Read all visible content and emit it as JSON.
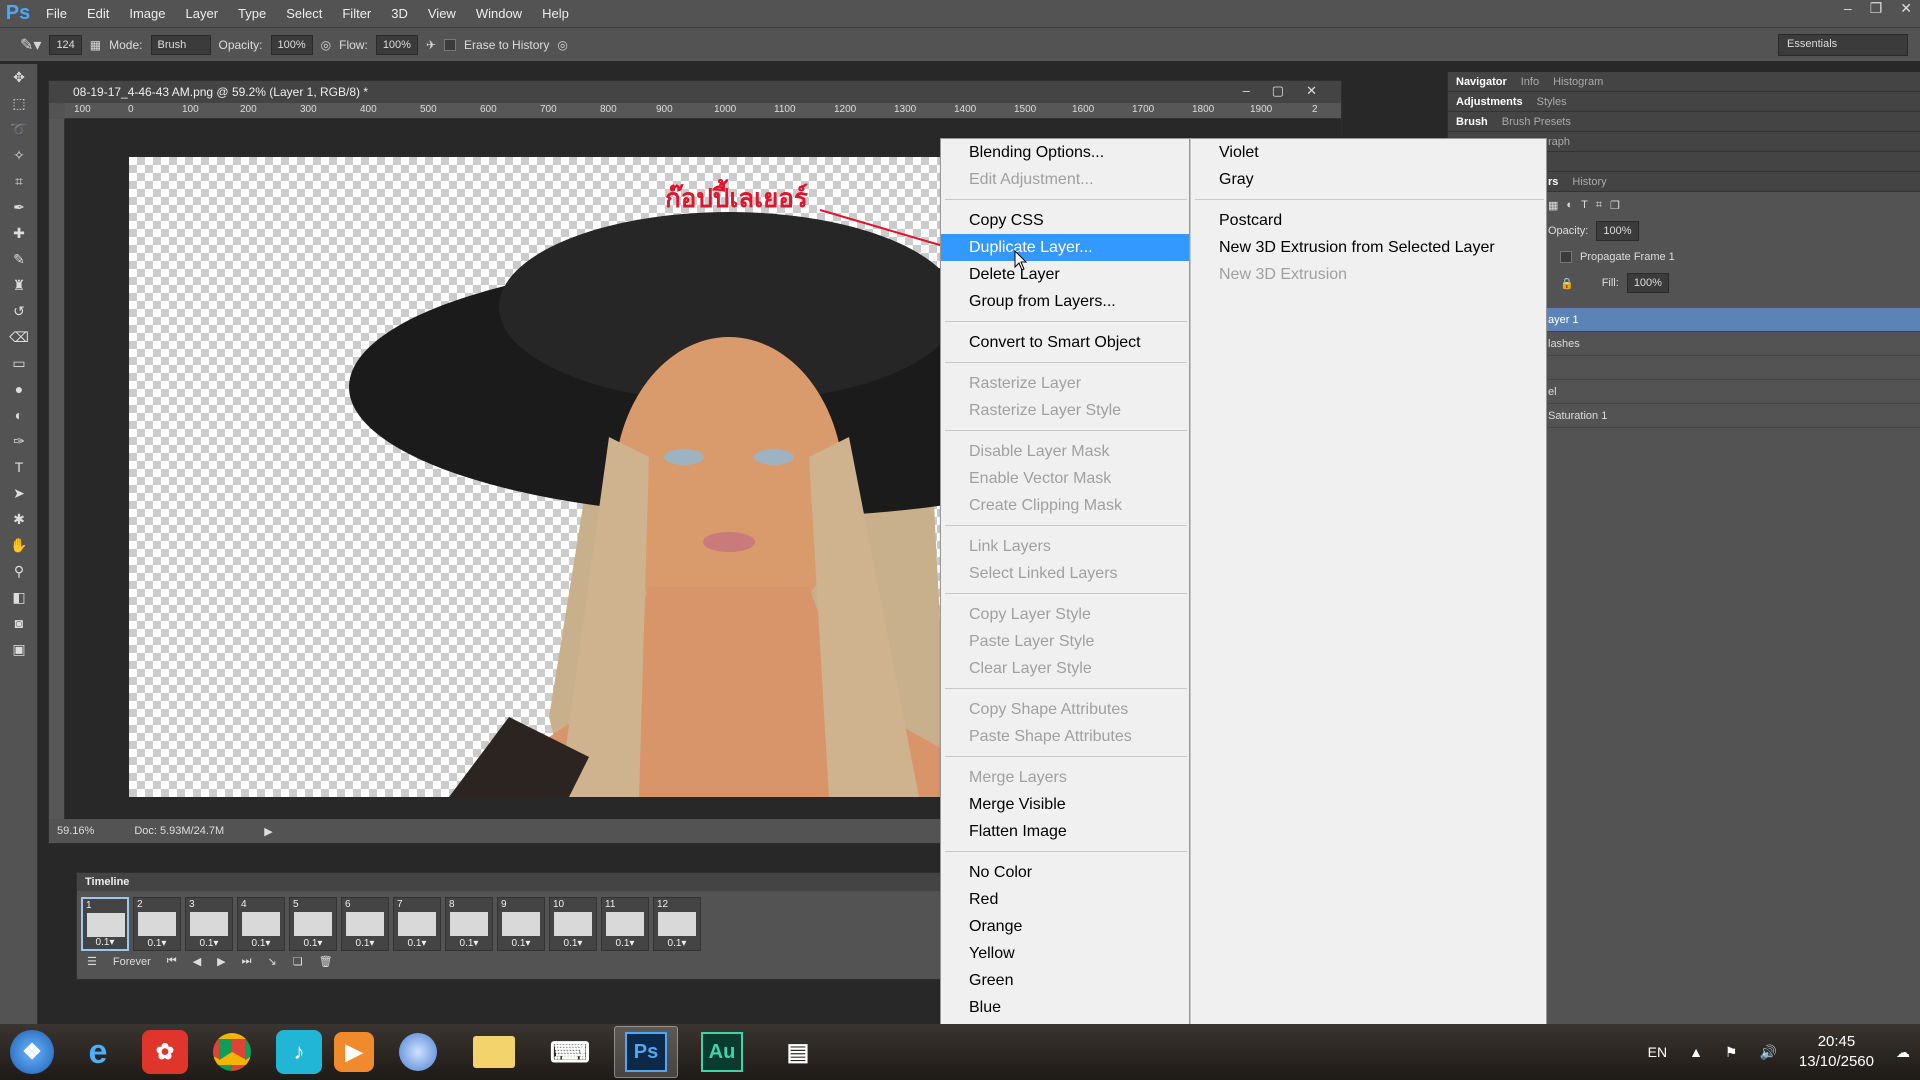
{
  "menubar": {
    "logo": "Ps",
    "items": [
      "File",
      "Edit",
      "Image",
      "Layer",
      "Type",
      "Select",
      "Filter",
      "3D",
      "View",
      "Window",
      "Help"
    ]
  },
  "options": {
    "brush_size": "124",
    "mode_label": "Mode:",
    "mode_value": "Brush",
    "opacity_label": "Opacity:",
    "opacity_value": "100%",
    "flow_label": "Flow:",
    "flow_value": "100%",
    "erase_history_label": "Erase to History",
    "workspace": "Essentials"
  },
  "document": {
    "title": "08-19-17_4-46-43 AM.png @ 59.2% (Layer 1, RGB/8) *",
    "ruler_ticks": [
      "100",
      "0",
      "100",
      "200",
      "300",
      "400",
      "500",
      "600",
      "700",
      "800",
      "900",
      "1000",
      "1100",
      "1200",
      "1300",
      "1400",
      "1500",
      "1600",
      "1700",
      "1800",
      "1900",
      "2"
    ],
    "zoom": "59.16%",
    "doc_size": "Doc: 5.93M/24.7M"
  },
  "annotation": {
    "text": "ก๊อปปี้เลเยอร์",
    "color": "#e0152b"
  },
  "timeline": {
    "tab": "Timeline",
    "frames": [
      {
        "num": "1",
        "dur": "0.1▾"
      },
      {
        "num": "2",
        "dur": "0.1▾"
      },
      {
        "num": "3",
        "dur": "0.1▾"
      },
      {
        "num": "4",
        "dur": "0.1▾"
      },
      {
        "num": "5",
        "dur": "0.1▾"
      },
      {
        "num": "6",
        "dur": "0.1▾"
      },
      {
        "num": "7",
        "dur": "0.1▾"
      },
      {
        "num": "8",
        "dur": "0.1▾"
      },
      {
        "num": "9",
        "dur": "0.1▾"
      },
      {
        "num": "10",
        "dur": "0.1▾"
      },
      {
        "num": "11",
        "dur": "0.1▾"
      },
      {
        "num": "12",
        "dur": "0.1▾"
      }
    ],
    "loop": "Forever"
  },
  "panels": {
    "tabs_1": [
      "Navigator",
      "Info",
      "Histogram"
    ],
    "tabs_2": [
      "Adjustments",
      "Styles"
    ],
    "tabs_3": [
      "Brush",
      "Brush Presets"
    ],
    "tab_partial_4": "raph",
    "tab_partial_5": "rs",
    "tab_history": "History",
    "layer_opacity_label": "Opacity:",
    "layer_opacity_value": "100%",
    "propagate": "Propagate Frame 1",
    "fill_label": "Fill:",
    "fill_value": "100%",
    "layers": [
      "ayer 1",
      "lashes",
      "",
      "el",
      "Saturation 1"
    ]
  },
  "context_menu": {
    "col1": [
      {
        "label": "Blending Options...",
        "state": "enabled"
      },
      {
        "label": "Edit Adjustment...",
        "state": "disabled"
      },
      {
        "sep": true
      },
      {
        "label": "Copy CSS",
        "state": "enabled"
      },
      {
        "label": "Duplicate Layer...",
        "state": "highlighted"
      },
      {
        "label": "Delete Layer",
        "state": "enabled"
      },
      {
        "label": "Group from Layers...",
        "state": "enabled"
      },
      {
        "sep": true
      },
      {
        "label": "Convert to Smart Object",
        "state": "enabled"
      },
      {
        "sep": true
      },
      {
        "label": "Rasterize Layer",
        "state": "disabled"
      },
      {
        "label": "Rasterize Layer Style",
        "state": "disabled"
      },
      {
        "sep": true
      },
      {
        "label": "Disable Layer Mask",
        "state": "disabled"
      },
      {
        "label": "Enable Vector Mask",
        "state": "disabled"
      },
      {
        "label": "Create Clipping Mask",
        "state": "disabled"
      },
      {
        "sep": true
      },
      {
        "label": "Link Layers",
        "state": "disabled"
      },
      {
        "label": "Select Linked Layers",
        "state": "disabled"
      },
      {
        "sep": true
      },
      {
        "label": "Copy Layer Style",
        "state": "disabled"
      },
      {
        "label": "Paste Layer Style",
        "state": "disabled"
      },
      {
        "label": "Clear Layer Style",
        "state": "disabled"
      },
      {
        "sep": true
      },
      {
        "label": "Copy Shape Attributes",
        "state": "disabled"
      },
      {
        "label": "Paste Shape Attributes",
        "state": "disabled"
      },
      {
        "sep": true
      },
      {
        "label": "Merge Layers",
        "state": "disabled"
      },
      {
        "label": "Merge Visible",
        "state": "enabled"
      },
      {
        "label": "Flatten Image",
        "state": "enabled"
      },
      {
        "sep": true
      },
      {
        "label": "No Color",
        "state": "enabled"
      },
      {
        "label": "Red",
        "state": "enabled"
      },
      {
        "label": "Orange",
        "state": "enabled"
      },
      {
        "label": "Yellow",
        "state": "enabled"
      },
      {
        "label": "Green",
        "state": "enabled"
      },
      {
        "label": "Blue",
        "state": "enabled"
      }
    ],
    "col2": [
      {
        "label": "Violet",
        "state": "enabled"
      },
      {
        "label": "Gray",
        "state": "enabled"
      },
      {
        "sep": true
      },
      {
        "label": "Postcard",
        "state": "enabled"
      },
      {
        "label": "New 3D Extrusion from Selected Layer",
        "state": "enabled"
      },
      {
        "label": "New 3D Extrusion",
        "state": "disabled"
      }
    ]
  },
  "taskbar": {
    "apps": [
      "start-orb",
      "internet-explorer",
      "app-red",
      "chrome",
      "music-app",
      "media-player",
      "ie-blue",
      "file-explorer",
      "keyboard-app",
      "photoshop",
      "audition",
      "game-app"
    ],
    "ps_label": "Ps",
    "au_label": "Au",
    "lang": "EN",
    "time": "20:45",
    "date": "13/10/2560"
  }
}
